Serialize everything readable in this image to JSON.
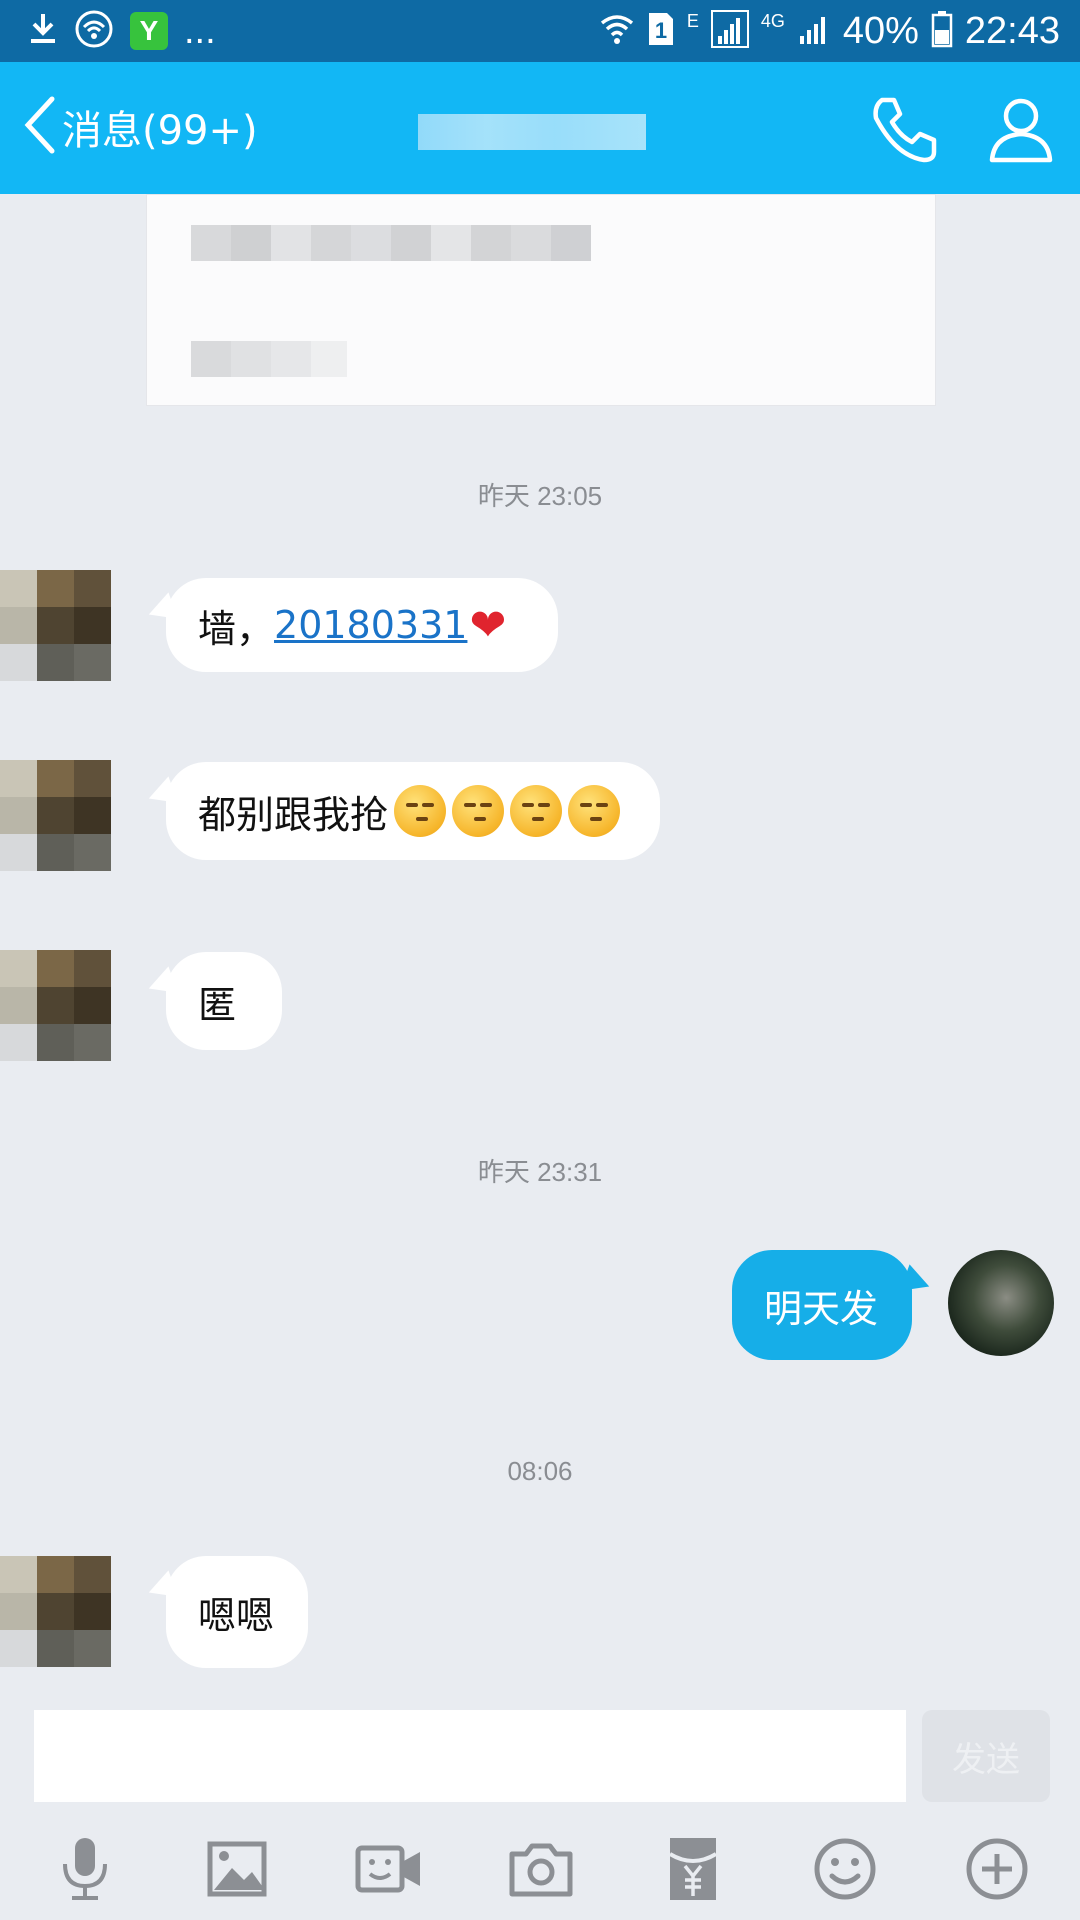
{
  "status_bar": {
    "network_type": "E",
    "sim_slot": "1",
    "lte_label": "4G",
    "battery": "40%",
    "time": "22:43",
    "overflow": "...",
    "app_badge": "Y"
  },
  "header": {
    "back_label": "消息(99+)"
  },
  "chat": {
    "timestamps": [
      "昨天 23:05",
      "昨天 23:31",
      "08:06"
    ],
    "messages": [
      {
        "text_prefix": "墙，",
        "link": "20180331",
        "heart": "❤"
      },
      {
        "text": "都别跟我抢"
      },
      {
        "text": "匿"
      },
      {
        "text": "明天发"
      },
      {
        "text": "嗯嗯"
      }
    ]
  },
  "input": {
    "value": "",
    "send_label": "发送"
  },
  "icons": {
    "download": "download-icon",
    "wifi": "wifi-icon",
    "signal": "signal-icon",
    "battery": "battery-icon",
    "back": "chevron-left-icon",
    "call": "phone-icon",
    "profile": "person-icon",
    "voice": "microphone-icon",
    "image": "image-icon",
    "video": "video-call-icon",
    "camera": "camera-icon",
    "red_packet": "red-packet-icon",
    "emoji": "emoji-icon",
    "plus": "plus-circle-icon"
  },
  "colors": {
    "title_bar": "#12b7f5",
    "status_bar": "#0e6aa4",
    "out_bubble": "#16aee8",
    "background": "#e9ecf1",
    "link": "#1a73c8"
  }
}
